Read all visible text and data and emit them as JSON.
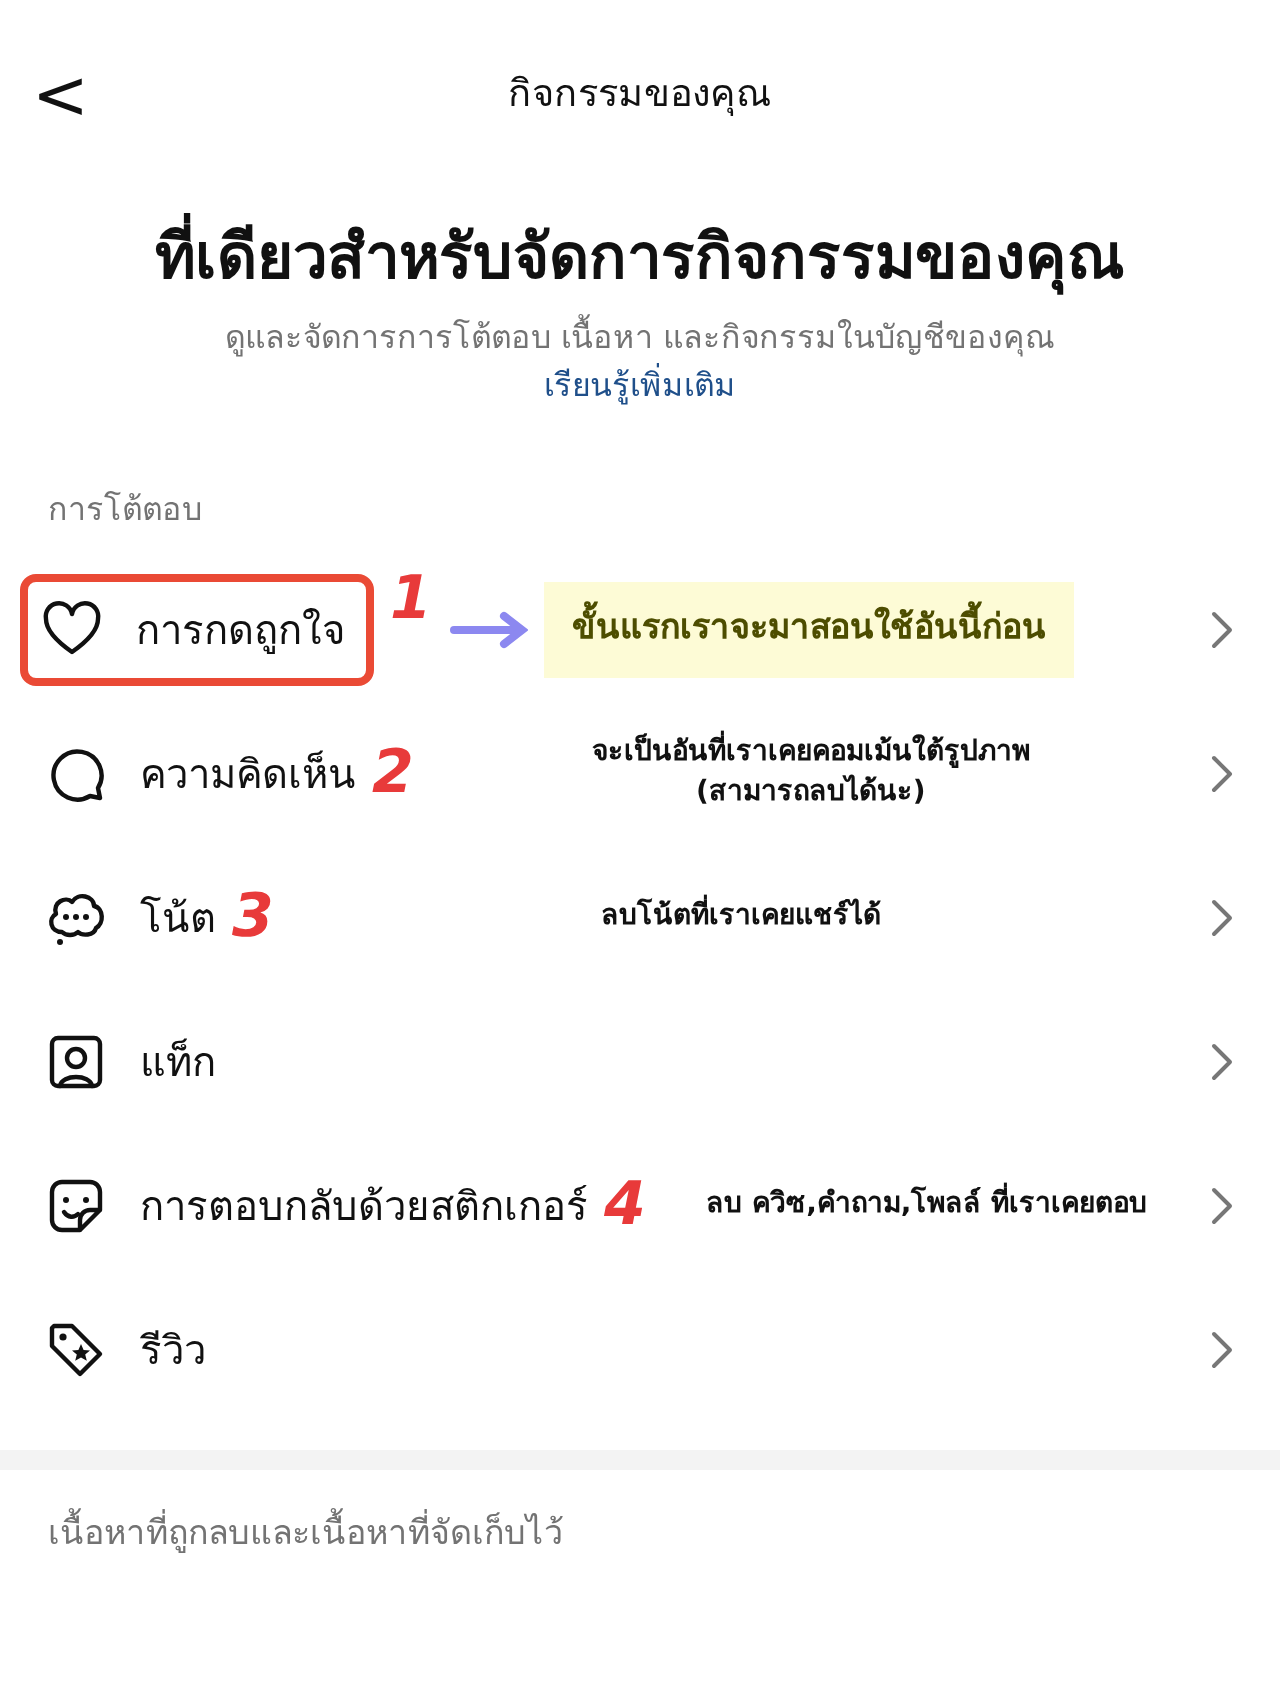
{
  "header": {
    "back_glyph": "<",
    "title": "กิจกรรมของคุณ"
  },
  "heading": "ที่เดียวสำหรับจัดการกิจกรรมของคุณ",
  "subtitle": {
    "text": "ดูและจัดการการโต้ตอบ เนื้อหา และกิจกรรมในบัญชีของคุณ",
    "link": "เรียนรู้เพิ่มเติม"
  },
  "section": "การโต้ตอบ",
  "items": [
    {
      "kind": "heart",
      "label": "การกดถูกใจ",
      "annotation": {
        "number": "1",
        "note": "ขั้นแรกเราจะมาสอนใช้อันนี้ก่อน",
        "boxed": true,
        "arrow": true,
        "highlight": true
      }
    },
    {
      "kind": "comment",
      "label": "ความคิดเห็น",
      "annotation": {
        "number": "2",
        "note": "จะเป็นอันที่เราเคยคอมเม้นใต้รูปภาพ\n(สามารถลบได้นะ)",
        "boxed": false,
        "arrow": false,
        "highlight": false
      }
    },
    {
      "kind": "note",
      "label": "โน้ต",
      "annotation": {
        "number": "3",
        "note": "ลบโน้ตที่เราเคยแชร์ได้",
        "boxed": false,
        "arrow": false,
        "highlight": false
      }
    },
    {
      "kind": "tag",
      "label": "แท็ก"
    },
    {
      "kind": "sticker",
      "label": "การตอบกลับด้วยสติกเกอร์",
      "annotation": {
        "number": "4",
        "note": "ลบ ควิซ,คำถาม,โพลล์ ที่เราเคยตอบ",
        "boxed": false,
        "arrow": false,
        "highlight": false
      }
    },
    {
      "kind": "review",
      "label": "รีวิว"
    }
  ],
  "footer_section": "เนื้อหาที่ถูกลบและเนื้อหาที่จัดเก็บไว้"
}
